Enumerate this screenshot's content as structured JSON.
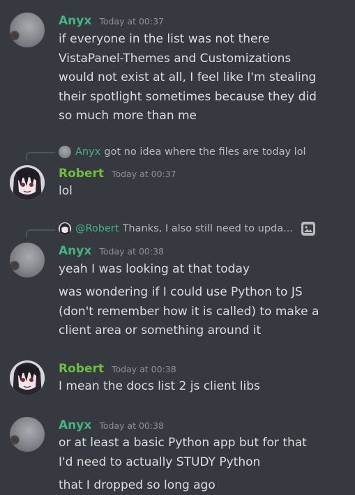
{
  "messages": [
    {
      "author": "Anyx",
      "timestamp": "Today at 00:37",
      "lines": [
        "if everyone in the list was not there",
        "VistaPanel-Themes and Customizations",
        "would not exist at all, I feel like I'm stealing",
        "their spotlight sometimes because they did",
        "so much more than me"
      ]
    },
    {
      "reply": {
        "author": "Anyx",
        "text": "got no idea where the files are today lol"
      },
      "author": "Robert",
      "timestamp": "Today at 00:37",
      "lines": [
        "lol"
      ]
    },
    {
      "reply": {
        "author": "@Robert",
        "text": "Thanks, I also still need to upda..."
      },
      "author": "Anyx",
      "timestamp": "Today at 00:38",
      "lines": [
        "yeah I was looking at that today"
      ],
      "lines2": [
        "was wondering if I could use Python to JS",
        "(don't remember how it is called) to make a",
        "client area or something around it"
      ]
    },
    {
      "author": "Robert",
      "timestamp": "Today at 00:38",
      "lines": [
        "I mean the docs list 2 js client libs"
      ]
    },
    {
      "author": "Anyx",
      "timestamp": "Today at 00:38",
      "lines": [
        "or at least a basic Python app but for that",
        "I'd need to actually STUDY Python"
      ],
      "lines2": [
        "that I dropped so long ago"
      ]
    }
  ],
  "colors": {
    "background": "#36393f",
    "anyx_name": "#43b581",
    "robert_name": "#6fbf3f",
    "text": "#dcddde",
    "timestamp": "#8e9297"
  },
  "icons": {
    "reply_attachment": "image-icon"
  }
}
